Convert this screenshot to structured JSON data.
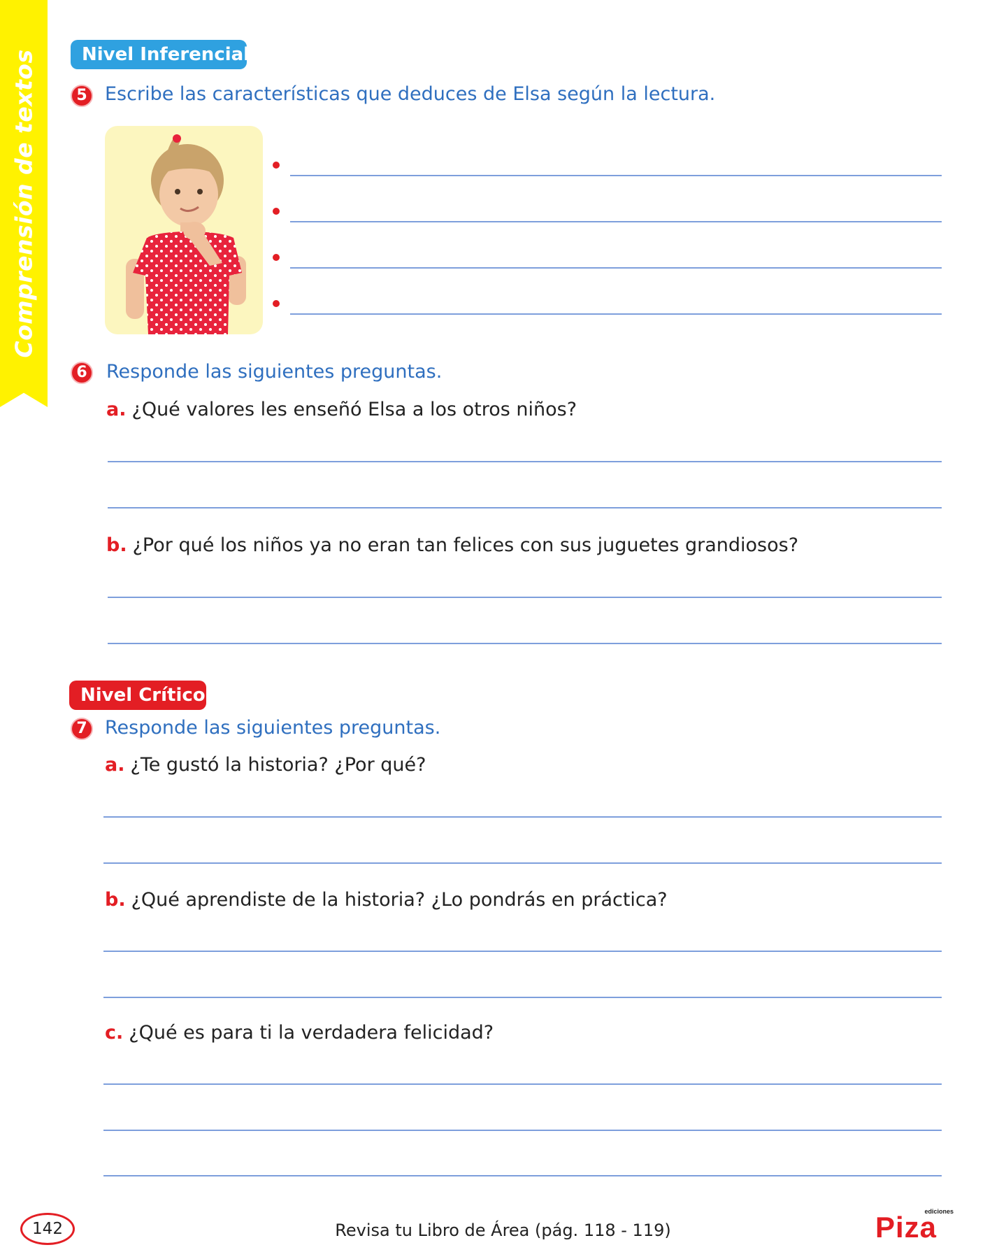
{
  "side_tab": {
    "text": "Comprensión de textos"
  },
  "section_inferencial": {
    "badge": "Nivel Inferencial",
    "q5": {
      "number": "5",
      "text": "Escribe las características que deduces de Elsa según la lectura."
    },
    "q6": {
      "number": "6",
      "text": "Responde las siguientes preguntas.",
      "a": {
        "letter": "a.",
        "text": "¿Qué valores les enseñó Elsa a los otros niños?"
      },
      "b": {
        "letter": "b.",
        "text": "¿Por qué los niños ya no eran tan felices con sus juguetes grandiosos?"
      }
    }
  },
  "section_critico": {
    "badge": "Nivel Crítico",
    "q7": {
      "number": "7",
      "text": "Responde las siguientes preguntas.",
      "a": {
        "letter": "a.",
        "text": "¿Te gustó la historia? ¿Por qué?"
      },
      "b": {
        "letter": "b.",
        "text": "¿Qué aprendiste de la historia? ¿Lo pondrás en práctica?"
      },
      "c": {
        "letter": "c.",
        "text": "¿Qué es para ti la verdadera felicidad?"
      }
    }
  },
  "footer": {
    "page_number": "142",
    "text": "Revisa tu Libro de Área (pág. 118 - 119)",
    "logo_small": "ediciones",
    "logo_main": "Piza"
  },
  "colors": {
    "accent_red": "#e31e24",
    "accent_blue": "#2fa1e0",
    "question_blue": "#2f6fbf",
    "line_blue": "#7e9fdc",
    "tab_yellow": "#fff200"
  }
}
